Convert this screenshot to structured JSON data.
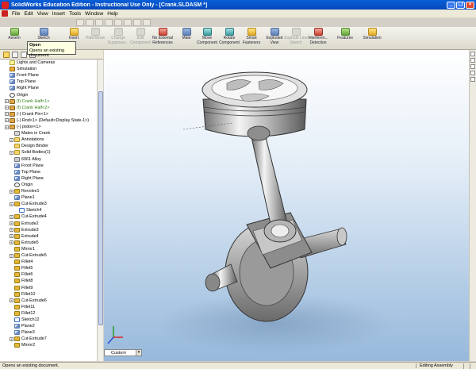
{
  "window": {
    "title": "SolidWorks Education Edition - Instructional Use Only - [Crank.SLDASM *]"
  },
  "menubar": {
    "items": [
      "File",
      "Edit",
      "View",
      "Insert",
      "Tools",
      "Window",
      "Help"
    ]
  },
  "commandbar": {
    "assembly": "Assem",
    "sketch": "Sketch",
    "insert": "Insert",
    "hide_show": "Hide/Show",
    "change_suppression": "Change Suppressi...",
    "edit_component": "Edit Component",
    "no_external_refs": "No External References",
    "mate": "Mate",
    "move_component": "Move Component",
    "rotate_component": "Rotate Component",
    "smart_fasteners": "Smart Fasteners",
    "exploded_view": "Exploded View",
    "explode_line_sketch": "Explode Line Sketch",
    "interference_detection": "Interferen... Detection",
    "features": "Features",
    "simulation": "Simulation"
  },
  "tooltip": {
    "title": "Open",
    "desc": "Opens an existing document."
  },
  "tree": [
    {
      "label": "Lights and Cameras",
      "icon": "light"
    },
    {
      "label": "Simulation",
      "icon": "sim"
    },
    {
      "label": "Front Plane",
      "icon": "plane"
    },
    {
      "label": "Top Plane",
      "icon": "plane"
    },
    {
      "label": "Right Plane",
      "icon": "plane"
    },
    {
      "label": "Origin",
      "icon": "origin"
    },
    {
      "label": "(f) Crank Half<1>",
      "icon": "part",
      "green": true
    },
    {
      "label": "(f) Crank Half<2>",
      "icon": "part",
      "green": true
    },
    {
      "label": "(-) Crank Pin<1>",
      "icon": "part"
    },
    {
      "label": "(-) Rod<1> (Default<Display State-1>)",
      "icon": "part"
    },
    {
      "label": "(-) piston<1>",
      "icon": "part"
    },
    {
      "label": "Mates in Crank",
      "icon": "mate"
    },
    {
      "label": "Annotations",
      "icon": "folder"
    },
    {
      "label": "Design Binder",
      "icon": "folder"
    },
    {
      "label": "Solid Bodies(1)",
      "icon": "folder"
    },
    {
      "label": "6061 Alloy",
      "icon": "mat"
    },
    {
      "label": "Front Plane",
      "icon": "plane"
    },
    {
      "label": "Top Plane",
      "icon": "plane"
    },
    {
      "label": "Right Plane",
      "icon": "plane"
    },
    {
      "label": "Origin",
      "icon": "origin"
    },
    {
      "label": "Revolve1",
      "icon": "feat"
    },
    {
      "label": "Plane1",
      "icon": "plane"
    },
    {
      "label": "Cut-Extrude3",
      "icon": "feat"
    },
    {
      "label": "Sketch4",
      "icon": "sketch"
    },
    {
      "label": "Cut-Extrude4",
      "icon": "feat"
    },
    {
      "label": "Extrude2",
      "icon": "feat"
    },
    {
      "label": "Extrude3",
      "icon": "feat"
    },
    {
      "label": "Extrude4",
      "icon": "feat"
    },
    {
      "label": "Extrude5",
      "icon": "feat"
    },
    {
      "label": "Mirror1",
      "icon": "feat"
    },
    {
      "label": "Cut-Extrude5",
      "icon": "feat"
    },
    {
      "label": "Fillet4",
      "icon": "feat"
    },
    {
      "label": "Fillet5",
      "icon": "feat"
    },
    {
      "label": "Fillet6",
      "icon": "feat"
    },
    {
      "label": "Fillet8",
      "icon": "feat"
    },
    {
      "label": "Fillet9",
      "icon": "feat"
    },
    {
      "label": "Fillet10",
      "icon": "feat"
    },
    {
      "label": "Cut-Extrude6",
      "icon": "feat"
    },
    {
      "label": "Fillet11",
      "icon": "feat"
    },
    {
      "label": "Fillet12",
      "icon": "feat"
    },
    {
      "label": "Sketch12",
      "icon": "sketch"
    },
    {
      "label": "Plane2",
      "icon": "plane"
    },
    {
      "label": "Plane3",
      "icon": "plane"
    },
    {
      "label": "Cut-Extrude7",
      "icon": "feat"
    },
    {
      "label": "Mirror2",
      "icon": "feat"
    }
  ],
  "view_select": {
    "value": "Custom"
  },
  "statusbar": {
    "message": "Opens an existing document.",
    "mode": "Editing Assembly"
  }
}
